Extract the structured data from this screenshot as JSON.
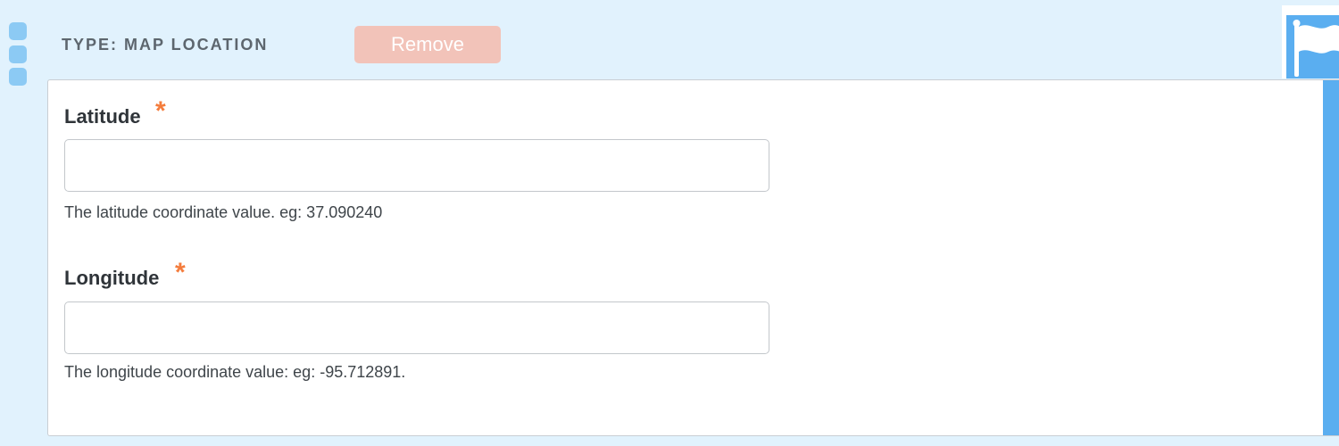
{
  "header": {
    "type_title": "TYPE: MAP LOCATION",
    "remove_label": "Remove"
  },
  "icons": {
    "drag_handle": "drag-handle-icon",
    "flag": "flag-icon"
  },
  "fields": {
    "latitude": {
      "label": "Latitude",
      "required_mark": "*",
      "value": "",
      "help": "The latitude coordinate value. eg: 37.090240"
    },
    "longitude": {
      "label": "Longitude",
      "required_mark": "*",
      "value": "",
      "help": "The longitude coordinate value: eg: -95.712891."
    }
  },
  "colors": {
    "background": "#e1f2fd",
    "accent": "#5aaef0",
    "remove_button": "#f2c3b9",
    "required": "#f47c3c"
  }
}
